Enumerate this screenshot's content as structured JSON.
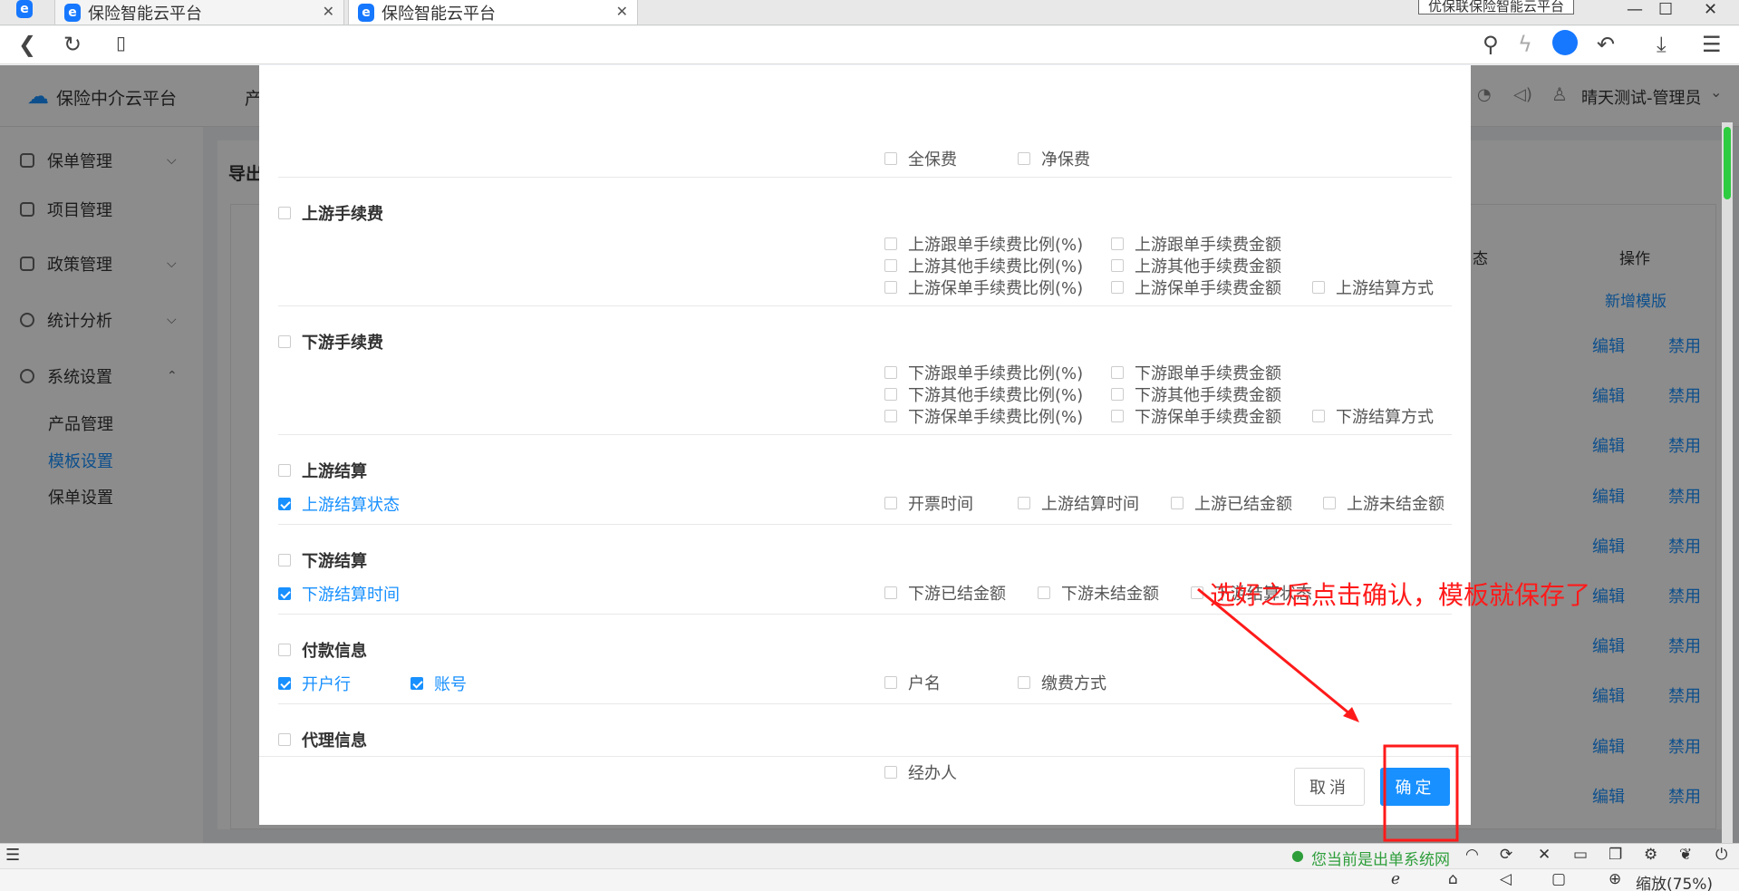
{
  "browser": {
    "tabs": [
      {
        "title": "保险智能云平台"
      },
      {
        "title": "保险智能云平台"
      }
    ],
    "ad_text": "优保联保险智能云平台",
    "zoom": "缩放(75%)",
    "status_text": "您当前是出单系统网"
  },
  "app": {
    "brand": "保险中介云平台",
    "header_nav_partial": "产",
    "user": "晴天测试-管理员",
    "page_title_partial": "导出",
    "sidebar": [
      {
        "label": "保单管理",
        "chevron": "down"
      },
      {
        "label": "项目管理",
        "chevron": ""
      },
      {
        "label": "政策管理",
        "chevron": "down"
      },
      {
        "label": "统计分析",
        "chevron": "down"
      },
      {
        "label": "系统设置",
        "chevron": "up"
      }
    ],
    "subitems": [
      "产品管理",
      "模板设置",
      "保单设置"
    ],
    "table": {
      "col_status_partial": "态",
      "col_ops": "操作",
      "add_template": "新增模版",
      "edit": "编辑",
      "disable": "禁用"
    }
  },
  "modal": {
    "top_row": [
      {
        "label": "全保费",
        "checked": false
      },
      {
        "label": "净保费",
        "checked": false
      }
    ],
    "sections": [
      {
        "title": "上游手续费",
        "items": [
          {
            "label": "上游跟单手续费比例(%)",
            "checked": false
          },
          {
            "label": "上游跟单手续费金额",
            "checked": false
          },
          {
            "label": "上游其他手续费比例(%)",
            "checked": false
          },
          {
            "label": "上游其他手续费金额",
            "checked": false
          },
          {
            "label": "上游保单手续费比例(%)",
            "checked": false
          },
          {
            "label": "上游保单手续费金额",
            "checked": false
          },
          {
            "label": "上游结算方式",
            "checked": false
          }
        ]
      },
      {
        "title": "下游手续费",
        "items": [
          {
            "label": "下游跟单手续费比例(%)",
            "checked": false
          },
          {
            "label": "下游跟单手续费金额",
            "checked": false
          },
          {
            "label": "下游其他手续费比例(%)",
            "checked": false
          },
          {
            "label": "下游其他手续费金额",
            "checked": false
          },
          {
            "label": "下游保单手续费比例(%)",
            "checked": false
          },
          {
            "label": "下游保单手续费金额",
            "checked": false
          },
          {
            "label": "下游结算方式",
            "checked": false
          }
        ]
      },
      {
        "title": "上游结算",
        "items": [
          {
            "label": "上游结算状态",
            "checked": true
          },
          {
            "label": "开票时间",
            "checked": false
          },
          {
            "label": "上游结算时间",
            "checked": false
          },
          {
            "label": "上游已结金额",
            "checked": false
          },
          {
            "label": "上游未结金额",
            "checked": false
          }
        ]
      },
      {
        "title": "下游结算",
        "items": [
          {
            "label": "下游结算时间",
            "checked": true
          },
          {
            "label": "下游已结金额",
            "checked": false
          },
          {
            "label": "下游未结金额",
            "checked": false
          },
          {
            "label": "下游结算状态",
            "checked": false
          }
        ]
      },
      {
        "title": "付款信息",
        "items": [
          {
            "label": "开户行",
            "checked": true
          },
          {
            "label": "账号",
            "checked": true
          },
          {
            "label": "户名",
            "checked": false
          },
          {
            "label": "缴费方式",
            "checked": false
          }
        ]
      },
      {
        "title": "代理信息",
        "items": [
          {
            "label": "经办人",
            "checked": false
          }
        ]
      }
    ],
    "cancel_label": "取消",
    "confirm_label": "确定"
  },
  "annotation": {
    "text": "选好之后点击确认，模板就保存了",
    "color": "#ff1a1a"
  },
  "colors": {
    "primary": "#1890ff",
    "annotation": "#ff1a1a"
  }
}
